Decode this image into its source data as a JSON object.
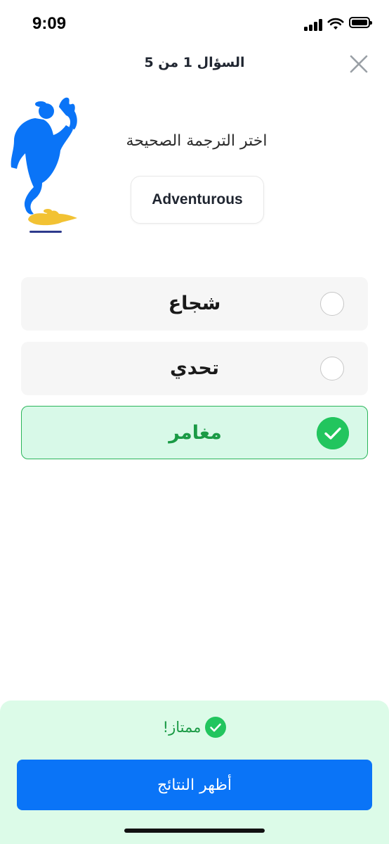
{
  "status_bar": {
    "time": "9:09"
  },
  "header": {
    "title": "السؤال 1 من 5",
    "close_icon": "close-icon"
  },
  "question": {
    "prompt": "اختر الترجمة الصحيحة",
    "word": "Adventurous",
    "illustration": "genie-with-lamp"
  },
  "options": [
    {
      "label": "شجاع",
      "selected": false
    },
    {
      "label": "تحدي",
      "selected": false
    },
    {
      "label": "مغامر",
      "selected": true
    }
  ],
  "feedback": {
    "text": "ممتاز!",
    "icon": "check-circle-icon"
  },
  "results_button": {
    "label": "أظهر النتائج"
  },
  "colors": {
    "accent": "#0a74f7",
    "success": "#22c55e",
    "success_bg": "#dcfbe8",
    "genie": "#0a74f7",
    "lamp": "#f2c233"
  }
}
